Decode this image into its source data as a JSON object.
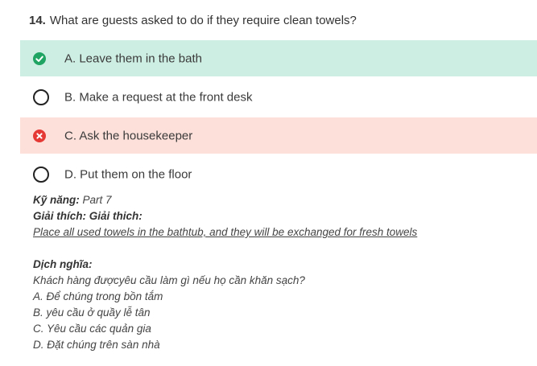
{
  "question": {
    "number": "14.",
    "text": "What are guests asked to do if they require clean towels?"
  },
  "options": [
    {
      "label": "A. Leave them in the bath",
      "state": "correct",
      "icon": "check-circle-icon"
    },
    {
      "label": "B. Make a request at the front desk",
      "state": "unselected",
      "icon": "radio-icon"
    },
    {
      "label": "C. Ask the housekeeper",
      "state": "wrong",
      "icon": "x-circle-icon"
    },
    {
      "label": "D. Put them on the floor",
      "state": "unselected",
      "icon": "radio-icon"
    }
  ],
  "explanation": {
    "skill_label": "Kỹ năng:",
    "skill_value": "Part 7",
    "explain_label": "Giải thích:",
    "explain_value": "Giải thich:",
    "explain_text": "Place all used towels in the bathtub, and they will be exchanged for fresh towels",
    "translation_label": "Dịch nghĩa:",
    "translation_lines": [
      "Khách hàng đượcyêu cầu làm gì nếu họ cần khăn sạch?",
      "A. Để chúng trong bồn tắm",
      "B. yêu cầu ở quầy lễ tân",
      "C. Yêu cầu các quản gia",
      "D. Đặt chúng trên sàn nhà"
    ]
  },
  "colors": {
    "correct_bg": "#cdeee2",
    "wrong_bg": "#fde0da",
    "correct_icon": "#1fa463",
    "wrong_icon": "#e53935"
  }
}
